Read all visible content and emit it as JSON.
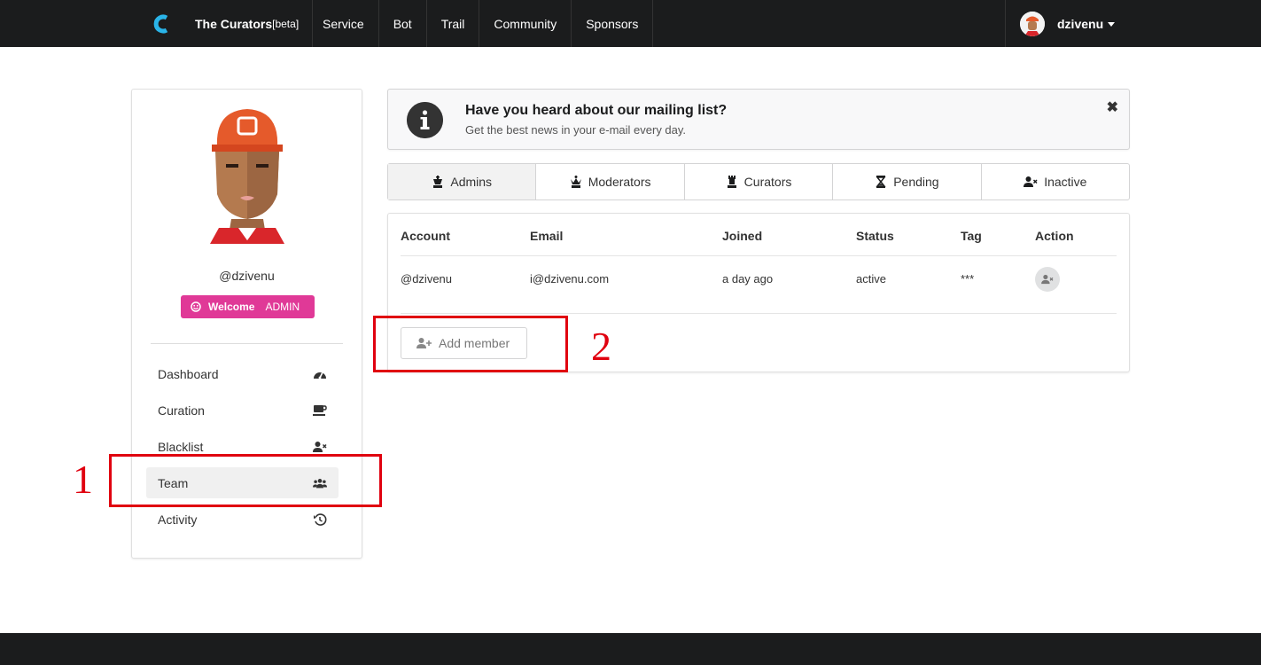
{
  "nav": {
    "brand": "The Curators",
    "brand_suffix": "[beta]",
    "links": [
      "Service",
      "Bot",
      "Trail",
      "Community",
      "Sponsors"
    ],
    "username": "dzivenu"
  },
  "sidebar": {
    "handle": "@dzivenu",
    "badge_welcome": "Welcome",
    "badge_role": "ADMIN",
    "menu": [
      {
        "label": "Dashboard",
        "icon": "tachometer-icon"
      },
      {
        "label": "Curation",
        "icon": "coffee-icon"
      },
      {
        "label": "Blacklist",
        "icon": "user-times-icon"
      },
      {
        "label": "Team",
        "icon": "users-icon"
      },
      {
        "label": "Activity",
        "icon": "history-icon"
      }
    ]
  },
  "message": {
    "header": "Have you heard about our mailing list?",
    "text": "Get the best news in your e-mail every day.",
    "close": "✖"
  },
  "tabs": [
    "Admins",
    "Moderators",
    "Curators",
    "Pending",
    "Inactive"
  ],
  "table": {
    "headers": [
      "Account",
      "Email",
      "Joined",
      "Status",
      "Tag",
      "Action"
    ],
    "rows": [
      {
        "account": "@dzivenu",
        "email": "i@dzivenu.com",
        "joined": "a day ago",
        "status": "active",
        "tag": "***"
      }
    ],
    "add_member": "Add member"
  },
  "annotations": [
    "1",
    "2"
  ],
  "colors": {
    "nav_bg": "#1b1c1d",
    "badge": "#e03997",
    "annotation": "#e0000f",
    "logo": "#2ab4e8"
  }
}
